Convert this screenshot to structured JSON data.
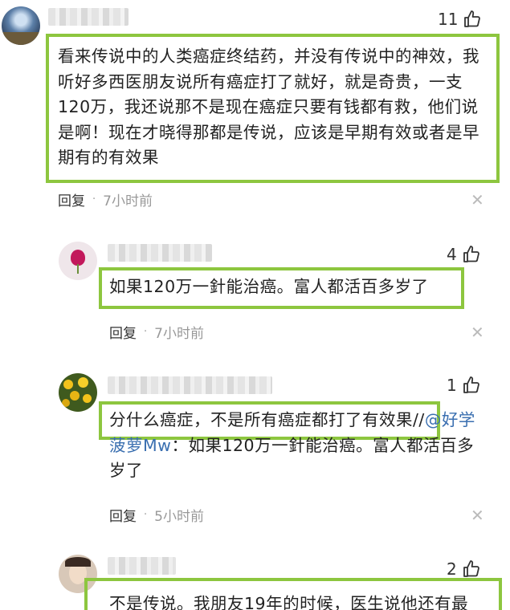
{
  "comments": [
    {
      "likes": "11",
      "text": "看来传说中的人类癌症终结药，并没有传说中的神效，我听好多西医朋友说所有癌症打了就好，就是奇贵，一支120万，我还说那不是现在癌症只要有钱都有救，他们说是啊！现在才晓得那都是传说，应该是早期有效或者是早期有的有效果",
      "reply_label": "回复",
      "time": "7小时前"
    },
    {
      "likes": "4",
      "text": "如果120万一針能治癌。富人都活百多岁了",
      "reply_label": "回复",
      "time": "7小时前"
    },
    {
      "likes": "1",
      "text": "分什么癌症，不是所有癌症都打了有效果",
      "quote_prefix": "//",
      "quote_mention": "@好学菠萝Mw",
      "quote_text": "：如果120万一針能治癌。富人都活百多岁了",
      "reply_label": "回复",
      "time": "5小时前"
    },
    {
      "likes": "2",
      "text": "不是传说。我朋友19年的时候，医生说他还有最"
    }
  ],
  "separator": "·",
  "icons": {
    "like": "thumbs-up-icon",
    "close": "close-icon"
  },
  "colors": {
    "highlight": "#8dc63f",
    "mention": "#3a6fb0",
    "muted": "#999999"
  }
}
